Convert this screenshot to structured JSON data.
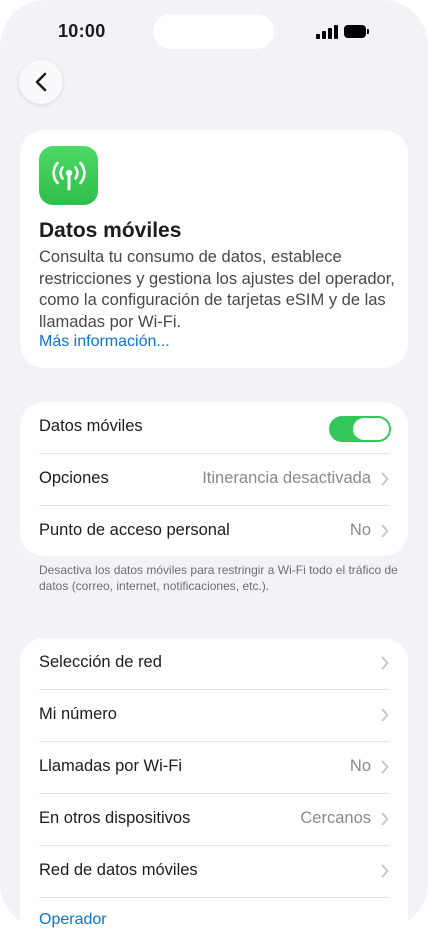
{
  "status_bar": {
    "time": "10:00"
  },
  "navigation": {
    "back_icon": "chevron-left-icon"
  },
  "intro": {
    "icon": "antenna-icon",
    "icon_color": "#34c759",
    "title": "Datos móviles",
    "description": "Consulta tu consumo de datos, establece restricciones y gestiona los ajustes del operador, como la configuración de tarjetas eSIM y de las llamadas por Wi-Fi.",
    "more_link": "Más información..."
  },
  "group1": {
    "rows": [
      {
        "label": "Datos móviles",
        "toggle_on": true
      },
      {
        "label": "Opciones",
        "value": "Itinerancia desactivada"
      },
      {
        "label": "Punto de acceso personal",
        "value": "No"
      }
    ],
    "footnote": "Desactiva los datos móviles para restringir a Wi-Fi todo el tráfico de datos (correo, internet, notificaciones, etc.)."
  },
  "group2": {
    "rows": [
      {
        "label": "Selección de red",
        "value": ""
      },
      {
        "label": "Mi número",
        "value": ""
      },
      {
        "label": "Llamadas por Wi-Fi",
        "value": "No"
      },
      {
        "label": "En otros dispositivos",
        "value": "Cercanos"
      },
      {
        "label": "Red de datos móviles",
        "value": ""
      }
    ],
    "operator_link": "Operador"
  },
  "colors": {
    "accent": "#0a74d8",
    "toggle_on": "#34c759",
    "background": "#f2f2f7"
  }
}
